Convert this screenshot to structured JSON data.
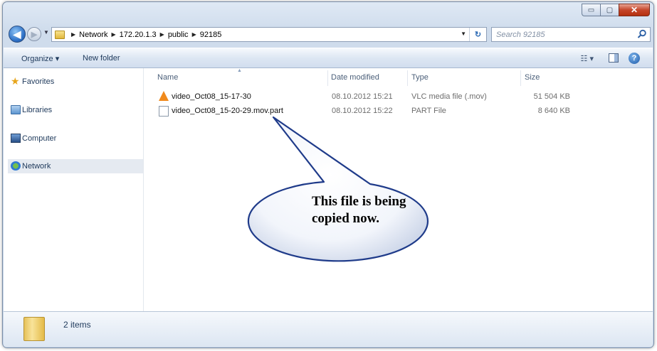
{
  "window": {
    "controls": {
      "minimize": "▭",
      "maximize": "▢",
      "close": "✕"
    }
  },
  "navbar": {
    "back_icon": "back-arrow-icon",
    "forward_icon": "forward-arrow-icon",
    "breadcrumb": [
      "Network",
      "172.20.1.3",
      "public",
      "92185"
    ],
    "search_placeholder": "Search 92185"
  },
  "commandbar": {
    "organize_label": "Organize ▾",
    "new_folder_label": "New folder",
    "view_label": "☷ ▾",
    "help_label": "?"
  },
  "nav_pane": {
    "items": [
      {
        "label": "Favorites",
        "icon": "star-icon"
      },
      {
        "label": "Libraries",
        "icon": "libraries-icon"
      },
      {
        "label": "Computer",
        "icon": "computer-icon"
      },
      {
        "label": "Network",
        "icon": "network-icon",
        "selected": true
      }
    ]
  },
  "file_list": {
    "columns": [
      "Name",
      "Date modified",
      "Type",
      "Size"
    ],
    "files": [
      {
        "name": "video_Oct08_15-17-30",
        "date": "08.10.2012 15:21",
        "type": "VLC media file (.mov)",
        "size": "51 504 KB",
        "icon": "vlc-icon"
      },
      {
        "name": "video_Oct08_15-20-29.mov.part",
        "date": "08.10.2012 15:22",
        "type": "PART File",
        "size": "8 640 KB",
        "icon": "document-icon"
      }
    ]
  },
  "callout": {
    "text": "This file is being copied now."
  },
  "details_pane": {
    "item_count": "2 items"
  }
}
